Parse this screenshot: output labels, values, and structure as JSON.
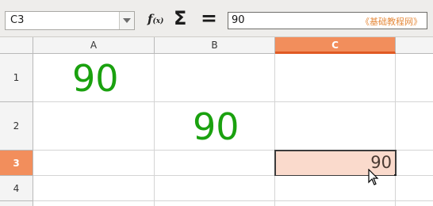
{
  "formula_bar": {
    "name_box_value": "C3",
    "fx_symbol": "f",
    "fx_suffix": "(x)",
    "sum_symbol": "Σ",
    "equals_symbol": "=",
    "formula_value": "90",
    "watermark": "《基础教程网》"
  },
  "columns": [
    "A",
    "B",
    "C"
  ],
  "rows": [
    "1",
    "2",
    "3",
    "4"
  ],
  "cells": {
    "A1": "90",
    "B2": "90",
    "C3": "90"
  },
  "selected_cell": "C3",
  "colors": {
    "selection_header": "#f28e5c",
    "selection_cell": "#fadacc",
    "green_text": "#1aa10f",
    "watermark": "#e58a3c"
  }
}
